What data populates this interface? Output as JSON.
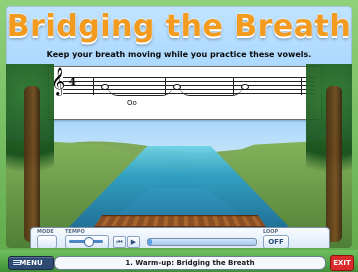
{
  "header": {
    "title": "Bridging the Breath",
    "subtitle": "Keep your breath moving while you practice these vowels."
  },
  "score": {
    "clef": "𝄞",
    "time_signature": "4",
    "lyric": "Oo"
  },
  "controls": {
    "label_mode": "MODE",
    "label_tempo": "TEMPO",
    "label_loop": "LOOP",
    "loop_value": "OFF",
    "button_rewind": "⏮",
    "button_play": "▶",
    "progress": 0.04,
    "tempo": 0.58
  },
  "bottom_bar": {
    "menu_label": "MENU",
    "track_title": "1. Warm-up: Bridging the Breath",
    "exit_label": "EXIT"
  },
  "colors": {
    "title": "#f39b1f",
    "exit": "#d92b2b",
    "menu": "#2f4b74"
  },
  "icons": {
    "menu": "menu-icon",
    "rewind": "rewind-icon",
    "play": "play-icon"
  }
}
